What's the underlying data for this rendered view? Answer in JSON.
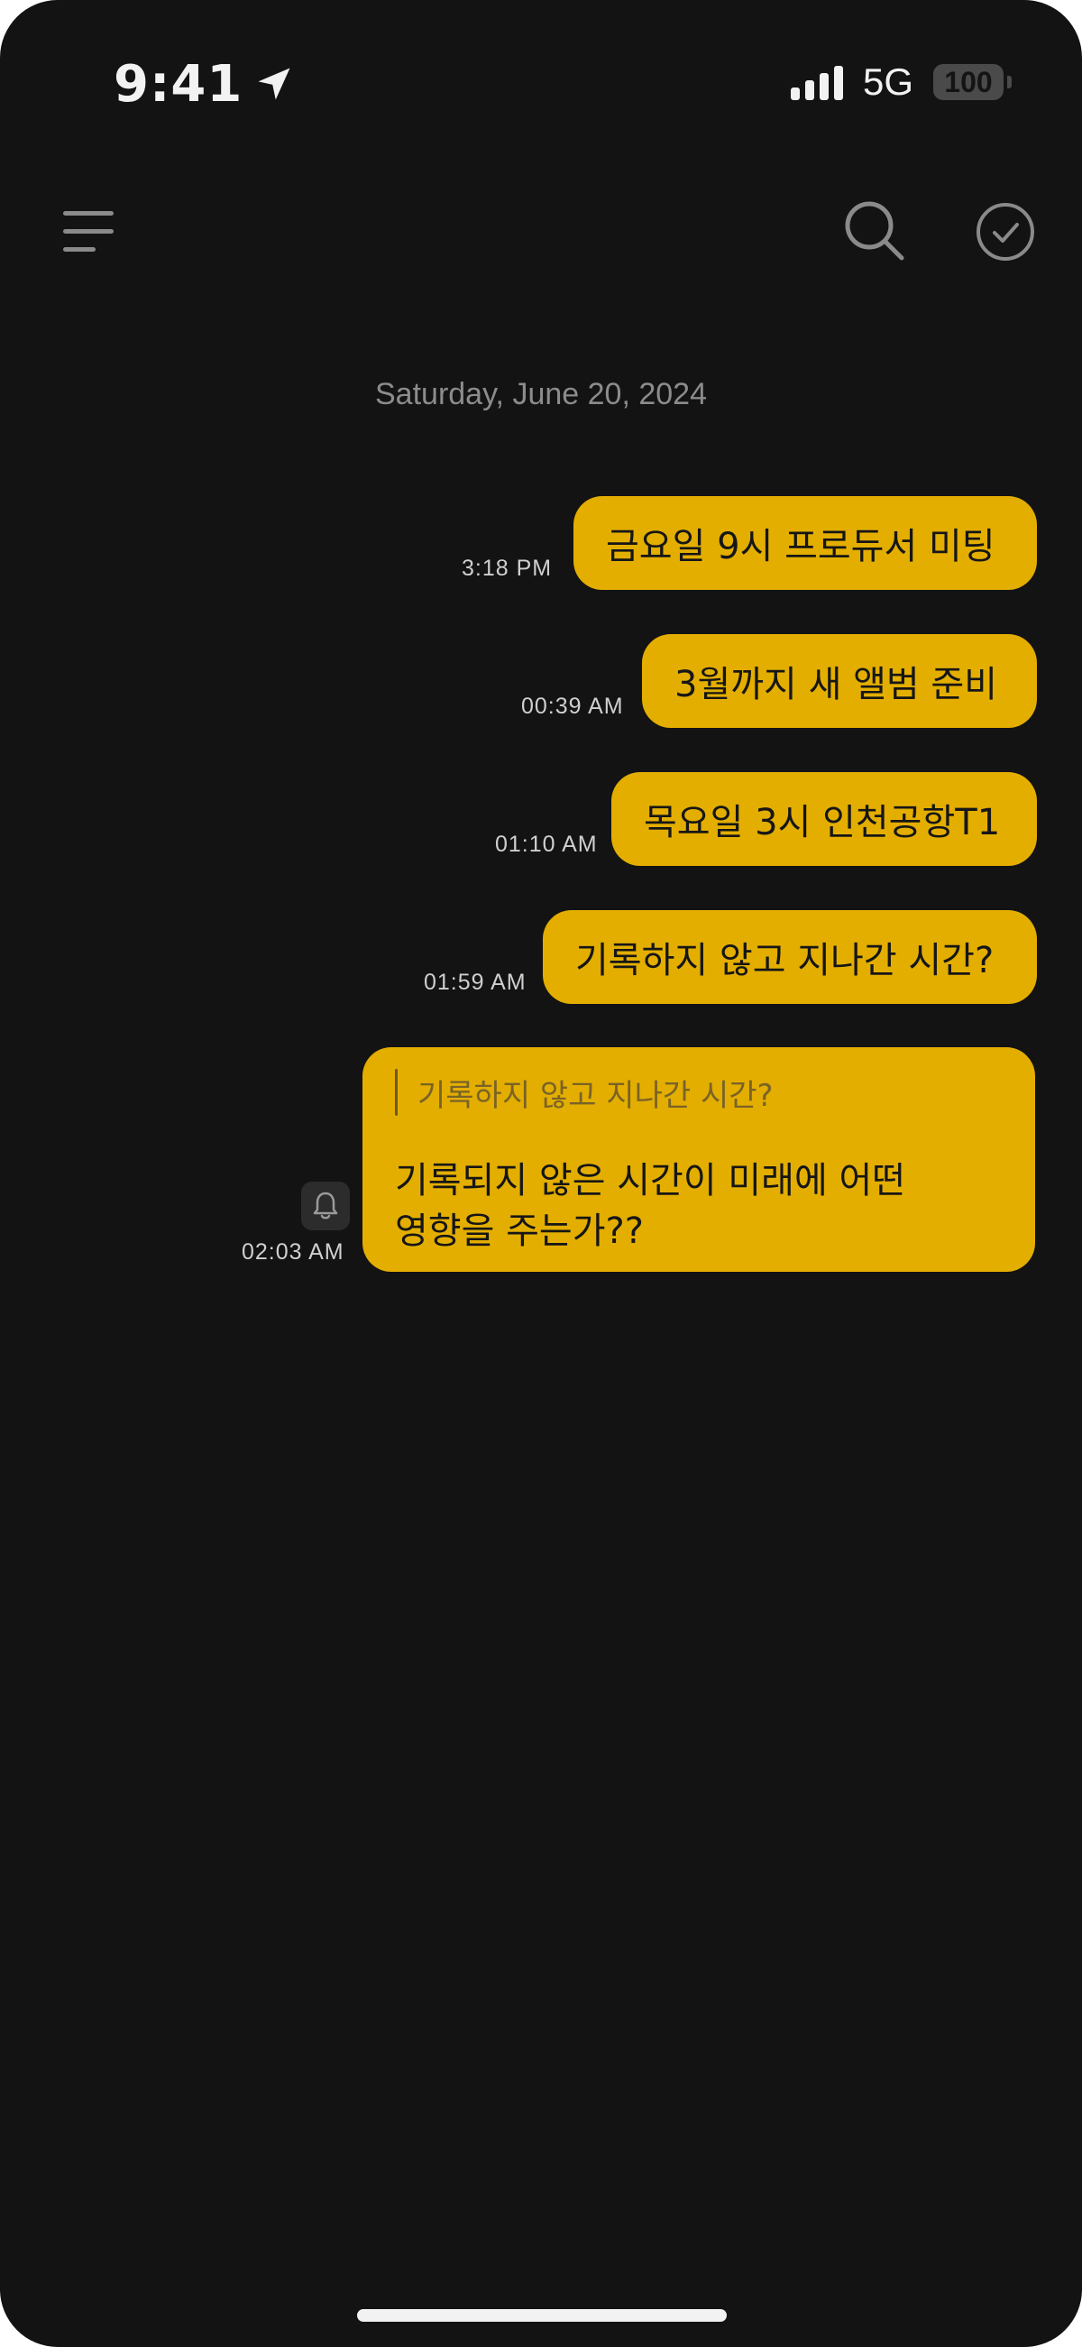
{
  "status_bar": {
    "time": "9:41",
    "network": "5G",
    "battery": "100"
  },
  "toolbar": {
    "menu_icon": "hamburger-icon",
    "search_icon": "search-icon",
    "select_icon": "check-circle-icon"
  },
  "chat": {
    "date": "Saturday, June 20, 2024",
    "messages": [
      {
        "text": "금요일 9시 프로듀서 미팅",
        "time": "3:18 PM"
      },
      {
        "text": "3월까지 새 앨범 준비",
        "time": "00:39 AM"
      },
      {
        "text": "목요일 3시 인천공항T1",
        "time": "01:10 AM"
      },
      {
        "text": "기록하지 않고 지나간 시간?",
        "time": "01:59 AM"
      }
    ],
    "reply": {
      "quote": "기록하지 않고 지나간 시간?",
      "text": "기록되지 않은 시간이 미래에 어떤 영향을 주는가??",
      "time": "02:03 AM",
      "badge_icon": "bell-icon"
    }
  },
  "colors": {
    "background": "#131313",
    "bubble": "#e3ae00",
    "muted_text": "#8c8c8c"
  }
}
